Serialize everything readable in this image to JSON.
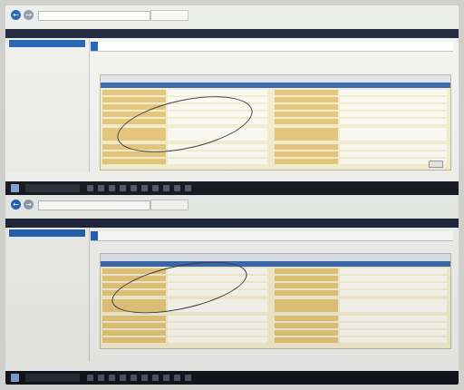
{
  "app": {
    "accent": "#1f5fb4",
    "taskbar_color": "#12161c"
  },
  "screenshots": [
    {
      "id": "top",
      "icons": [
        "back-icon",
        "forward-icon",
        "windows-start-icon",
        "search-icon"
      ],
      "panel_rows": 13
    },
    {
      "id": "bottom",
      "icons": [
        "back-icon",
        "forward-icon",
        "windows-start-icon",
        "search-icon"
      ],
      "panel_rows": 13
    }
  ]
}
